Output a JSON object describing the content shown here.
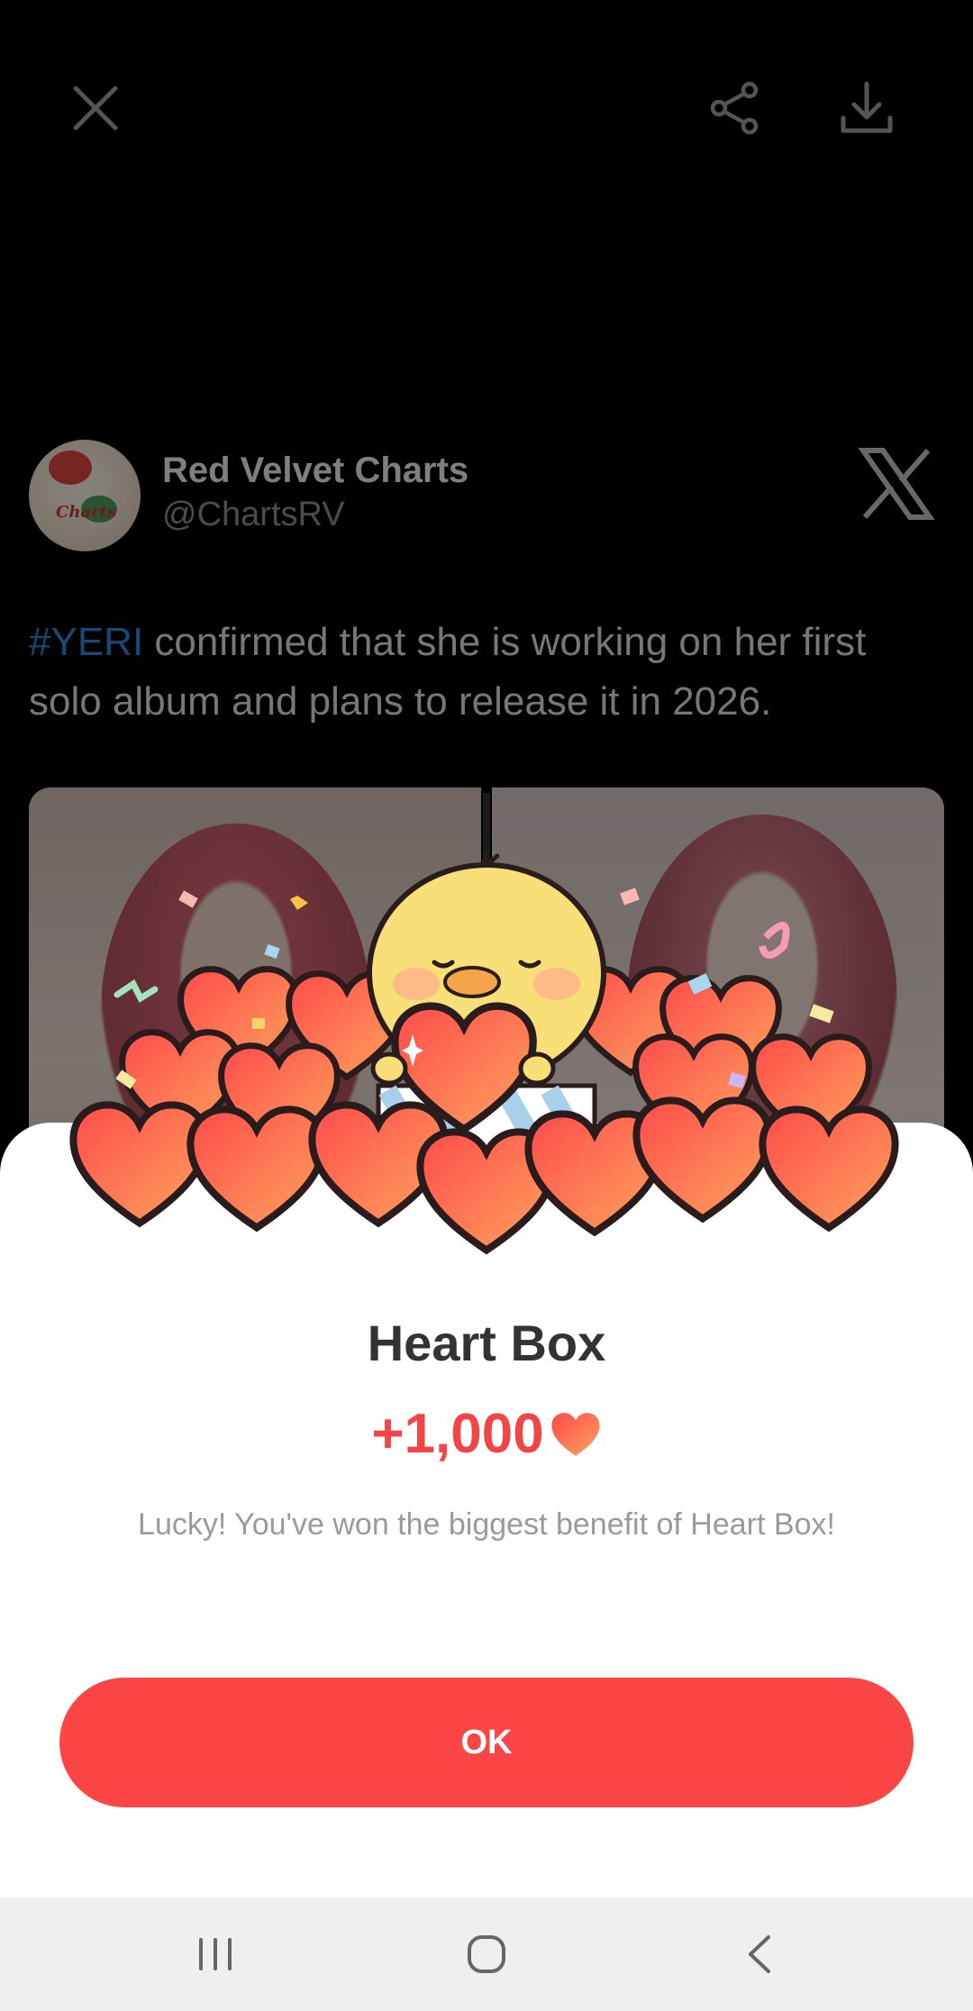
{
  "viewer": {
    "close_icon": "close-icon",
    "share_icon": "share-icon",
    "download_icon": "download-icon"
  },
  "tweet": {
    "name": "Red Velvet Charts",
    "handle": "@ChartsRV",
    "hashtag": "#YERI",
    "text": " confirmed that she is working on her first solo album and plans to release it in 2026.",
    "platform_icon": "x-logo-icon"
  },
  "dialog": {
    "title": "Heart Box",
    "reward_amount": "+1,000",
    "reward_icon": "heart-icon",
    "description": "Lucky! You've won the biggest benefit of Heart Box!",
    "ok_label": "OK"
  },
  "colors": {
    "accent": "#fc4545",
    "reward_text": "#f24646",
    "hashtag": "#2f82d8"
  },
  "navbar": {
    "recents_icon": "recents-icon",
    "home_icon": "home-icon",
    "back_icon": "back-icon"
  }
}
